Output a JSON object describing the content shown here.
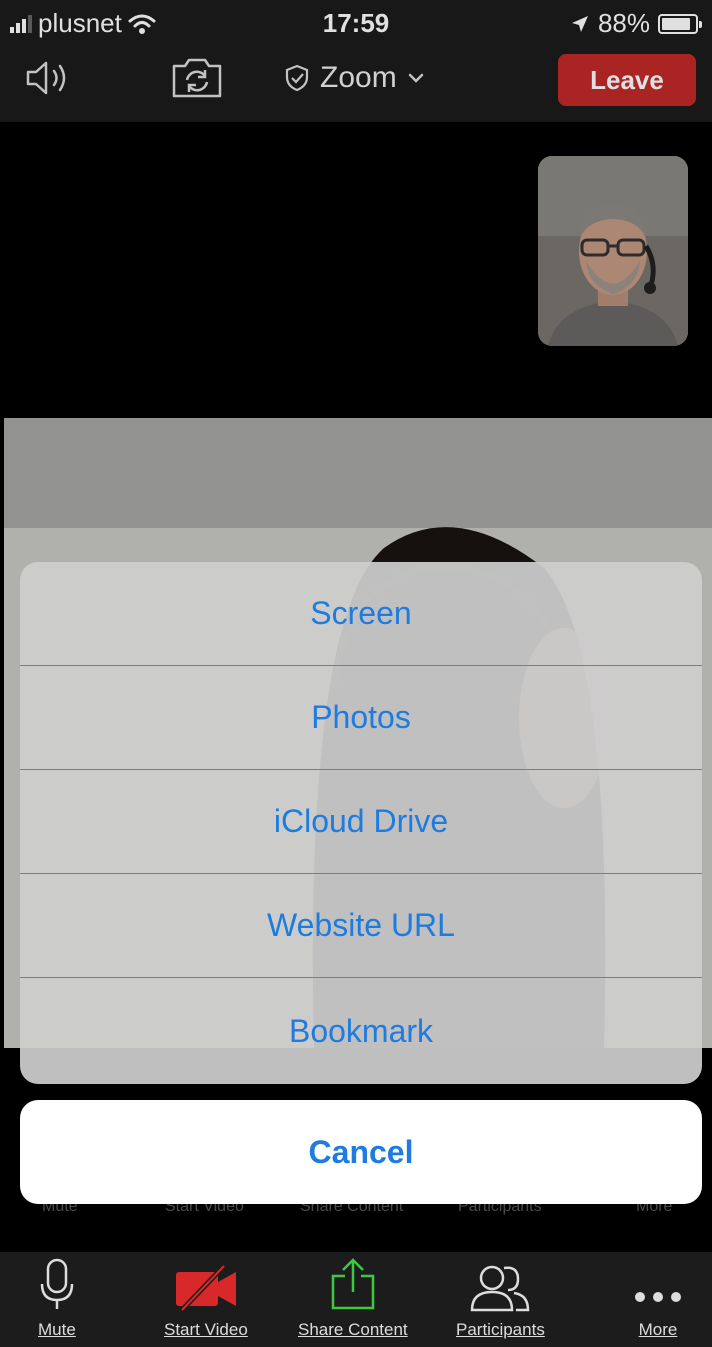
{
  "status_bar": {
    "carrier": "plusnet",
    "time": "17:59",
    "battery_percent": "88%",
    "battery_level": 0.88
  },
  "toolbar": {
    "title": "Zoom",
    "leave_label": "Leave",
    "leave_color": "#c2292a"
  },
  "action_sheet": {
    "items": [
      {
        "label": "Screen"
      },
      {
        "label": "Photos"
      },
      {
        "label": "iCloud Drive"
      },
      {
        "label": "Website URL"
      },
      {
        "label": "Bookmark"
      }
    ],
    "cancel_label": "Cancel",
    "accent_color": "#1e7be0"
  },
  "bottom_toolbar": {
    "items": [
      {
        "label": "Mute",
        "icon": "microphone-icon"
      },
      {
        "label": "Start Video",
        "icon": "video-off-icon"
      },
      {
        "label": "Share Content",
        "icon": "share-icon"
      },
      {
        "label": "Participants",
        "icon": "participants-icon"
      },
      {
        "label": "More",
        "icon": "more-icon"
      }
    ]
  }
}
